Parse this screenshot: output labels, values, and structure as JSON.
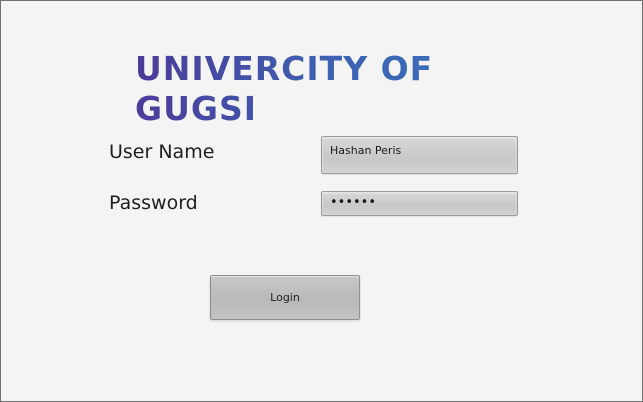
{
  "header": {
    "title": "UNIVERCITY OF GUGSI"
  },
  "form": {
    "username_label": "User Name",
    "password_label": "Password",
    "username_value": "Hashan Peris",
    "password_value": "••••••",
    "login_label": "Login"
  },
  "colors": {
    "title_gradient_start": "#4b3b9a",
    "title_gradient_end": "#3a75c4",
    "background": "#f4f4f4",
    "field_fill": "#cfcfcf"
  }
}
